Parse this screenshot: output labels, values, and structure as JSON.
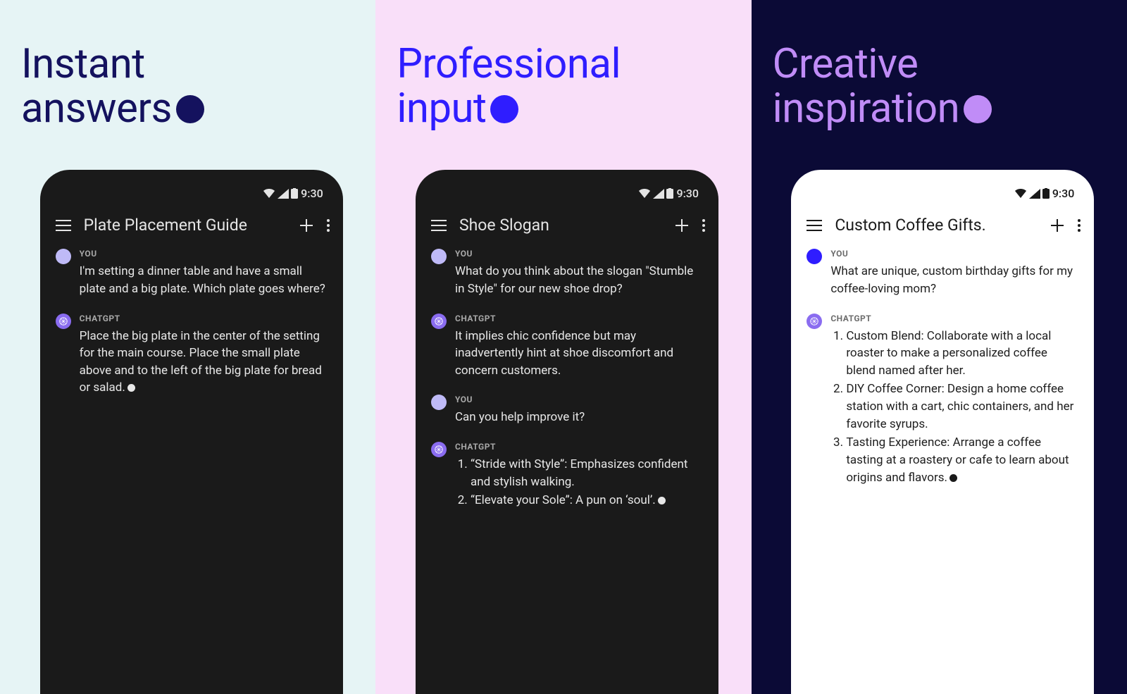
{
  "panels": [
    {
      "headline_l1": "Instant",
      "headline_l2": "answers",
      "statusbar_time": "9:30",
      "chat_title": "Plate Placement Guide",
      "messages": [
        {
          "role": "YOU",
          "type": "text",
          "text": "I'm setting a dinner table and have a small plate and a big plate. Which plate goes where?"
        },
        {
          "role": "CHATGPT",
          "type": "text",
          "text": "Place the big plate in the center of the setting for the main course. Place the small plate above and to the left of the big plate for bread or salad."
        }
      ]
    },
    {
      "headline_l1": "Professional",
      "headline_l2": "input",
      "statusbar_time": "9:30",
      "chat_title": "Shoe Slogan",
      "messages": [
        {
          "role": "YOU",
          "type": "text",
          "text": "What do you think about the slogan \"Stumble in Style\" for our new shoe drop?"
        },
        {
          "role": "CHATGPT",
          "type": "text",
          "text": "It implies chic confidence but may inadvertently hint at shoe discomfort and concern customers."
        },
        {
          "role": "YOU",
          "type": "text",
          "text": "Can you help improve it?"
        },
        {
          "role": "CHATGPT",
          "type": "list",
          "items": [
            "“Stride with Style”: Emphasizes confident and stylish walking.",
            "“Elevate your Sole”: A pun on ‘soul’."
          ]
        }
      ]
    },
    {
      "headline_l1": "Creative",
      "headline_l2": "inspiration",
      "statusbar_time": "9:30",
      "chat_title": "Custom Coffee Gifts.",
      "messages": [
        {
          "role": "YOU",
          "type": "text",
          "text": "What are unique, custom birthday gifts for my coffee-loving mom?"
        },
        {
          "role": "CHATGPT",
          "type": "list",
          "items": [
            "Custom Blend: Collaborate with a local roaster to make a personalized coffee blend named after her.",
            "DIY Coffee Corner: Design a home coffee station with a cart, chic containers, and her favorite syrups.",
            "Tasting Experience: Arrange a coffee tasting at a roastery or cafe to learn about origins and flavors."
          ]
        }
      ]
    }
  ]
}
